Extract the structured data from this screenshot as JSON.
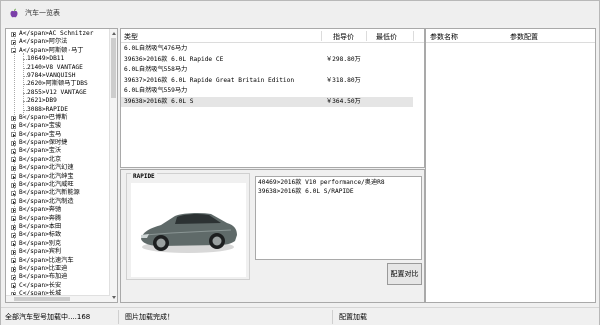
{
  "window": {
    "title": "汽车一览表",
    "icon": "apple-icon"
  },
  "tree": {
    "items": [
      {
        "label": "A</span>AC Schnitzer",
        "expander": "plus"
      },
      {
        "label": "A</span>阿尔法",
        "expander": "plus"
      },
      {
        "label": "A</span>阿斯顿·马丁",
        "expander": "minus"
      },
      {
        "label": "10649>DB11",
        "child": true
      },
      {
        "label": "2140>V8 VANTAGE",
        "child": true
      },
      {
        "label": "9784>VANQUISH",
        "child": true
      },
      {
        "label": "2620>阿斯顿马丁DBS",
        "child": true
      },
      {
        "label": "2855>V12 VANTAGE",
        "child": true
      },
      {
        "label": "2621>DB9",
        "child": true
      },
      {
        "label": "3088>RAPIDE",
        "child": true
      },
      {
        "label": "B</span>巴博斯",
        "expander": "plus"
      },
      {
        "label": "B</span>宝骏",
        "expander": "plus"
      },
      {
        "label": "B</span>宝马",
        "expander": "plus"
      },
      {
        "label": "B</span>保时捷",
        "expander": "plus"
      },
      {
        "label": "B</span>宝沃",
        "expander": "plus"
      },
      {
        "label": "B</span>北京",
        "expander": "plus"
      },
      {
        "label": "B</span>北汽幻速",
        "expander": "plus"
      },
      {
        "label": "B</span>北汽绅宝",
        "expander": "plus"
      },
      {
        "label": "B</span>北汽威旺",
        "expander": "plus"
      },
      {
        "label": "B</span>北汽新能源",
        "expander": "plus"
      },
      {
        "label": "B</span>北汽制造",
        "expander": "plus"
      },
      {
        "label": "B</span>奔驰",
        "expander": "plus"
      },
      {
        "label": "B</span>奔腾",
        "expander": "plus"
      },
      {
        "label": "B</span>本田",
        "expander": "plus"
      },
      {
        "label": "B</span>标致",
        "expander": "plus"
      },
      {
        "label": "B</span>别克",
        "expander": "plus"
      },
      {
        "label": "B</span>宾利",
        "expander": "plus"
      },
      {
        "label": "B</span>比速汽车",
        "expander": "plus"
      },
      {
        "label": "B</span>比亚迪",
        "expander": "plus"
      },
      {
        "label": "B</span>布加迪",
        "expander": "plus"
      },
      {
        "label": "C</span>长安",
        "expander": "plus"
      },
      {
        "label": "C</span>长城",
        "expander": "plus"
      }
    ]
  },
  "models": {
    "columns": [
      "类型",
      "指导价",
      "最低价"
    ],
    "rows": [
      {
        "name": "6.0L自然吸气476马力",
        "price": ""
      },
      {
        "name": "39636>2016款 6.0L Rapide CE",
        "price": "￥298.80万"
      },
      {
        "name": "6.0L自然吸气558马力",
        "price": ""
      },
      {
        "name": "39637>2016款 6.0L Rapide Great Britain Edition",
        "price": "￥318.80万"
      },
      {
        "name": "6.0L自然吸气559马力",
        "price": ""
      },
      {
        "name": "39638>2016款 6.0L S",
        "price": "￥364.50万",
        "selected": true
      }
    ]
  },
  "params": {
    "columns": [
      "参数名称",
      "参数配置"
    ]
  },
  "detail": {
    "photo_title": "RAPIDE",
    "car_color": "#5f6a69",
    "compare_items": [
      "40469>2016款 V10 performance/奥迪R8",
      "39638>2016款 6.0L S/RAPIDE"
    ],
    "compare_button": "配置对比"
  },
  "status": {
    "seg1": "全部汽车型号加载中....168",
    "seg2": "图片加载完成！",
    "seg3": "配置加载"
  }
}
